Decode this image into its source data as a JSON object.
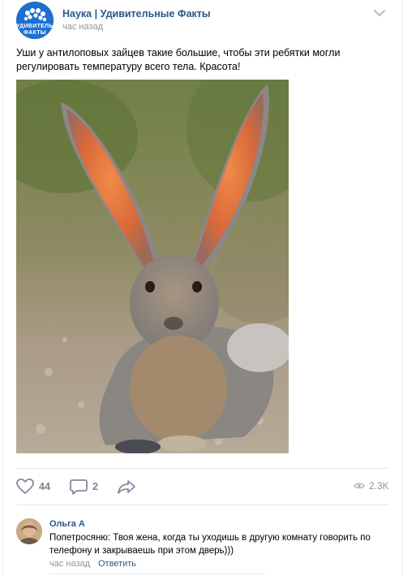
{
  "post": {
    "group_name": "Наука | Удивительные Факты",
    "group_avatar_text": "УДИВИТЕЛЬНЫЕ ФАКТЫ",
    "time": "час назад",
    "text": "Уши у антилоповых зайцев такие большие, чтобы эти ребятки могли регулировать температуру всего тела. Красота!",
    "image_icon": "photo-hare"
  },
  "actions": {
    "likes": "44",
    "comments": "2",
    "views": "2.3K",
    "like_icon": "heart-icon",
    "comment_icon": "comment-bubble-icon",
    "share_icon": "share-arrow-icon",
    "views_icon": "eye-icon"
  },
  "comment": {
    "author": "Ольга А",
    "text": "Попетросяню: Твоя жена, когда ты уходишь в другую комнату говорить по телефону и закрываешь при этом дверь)))",
    "time": "час назад",
    "reply_label": "Ответить"
  },
  "colors": {
    "link": "#2a5885",
    "meta": "#939393",
    "icon": "#828282",
    "avatar_bg": "#1e6fd0"
  }
}
